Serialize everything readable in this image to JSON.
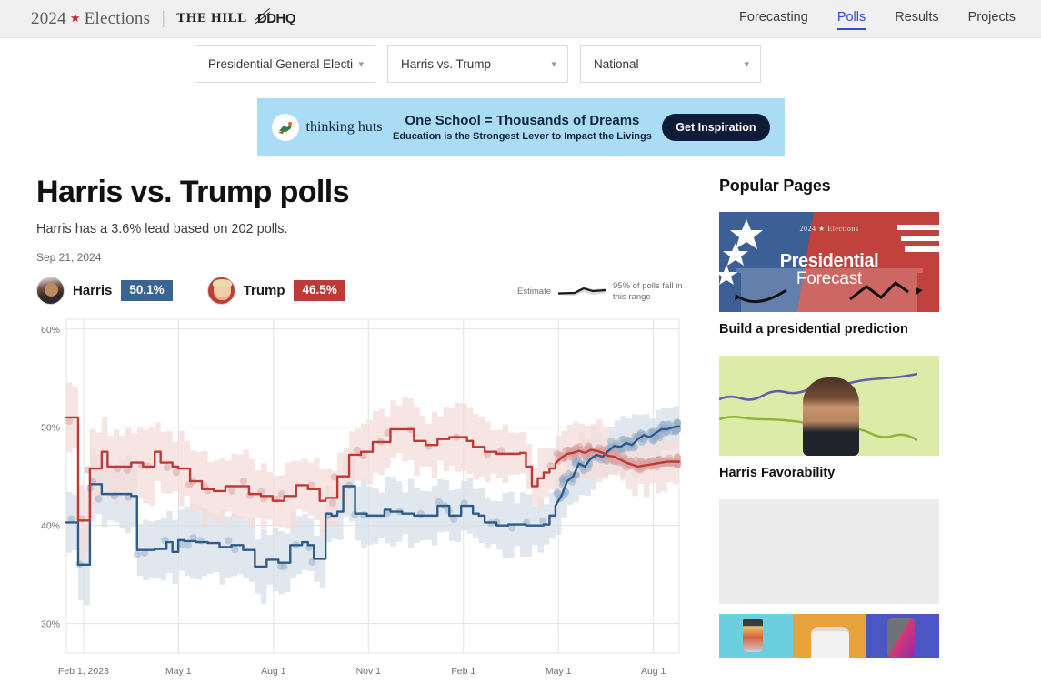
{
  "header": {
    "brand_year": "2024",
    "brand_star": "★",
    "brand_elections": "Elections",
    "brand_divider": "|",
    "brand_hill": "THE HILL",
    "brand_ddhq": "DDHQ",
    "nav": [
      {
        "label": "Forecasting",
        "active": false
      },
      {
        "label": "Polls",
        "active": true
      },
      {
        "label": "Results",
        "active": false
      },
      {
        "label": "Projects",
        "active": false
      }
    ],
    "accent_color": "#2f4ed8"
  },
  "filters": [
    {
      "name": "race-type",
      "value": "Presidential General Electi",
      "chevron": "chevron-down-icon"
    },
    {
      "name": "matchup",
      "value": "Harris vs. Trump",
      "chevron": "chevron-down-icon"
    },
    {
      "name": "geography",
      "value": "National",
      "chevron": "chevron-down-icon"
    }
  ],
  "ad": {
    "brand": "thinking huts",
    "logo_icon": "bird-icon",
    "logo_glyph": "🐦",
    "headline": "One School = Thousands of Dreams",
    "subline": "Education is the Strongest Lever to Impact the Livings",
    "cta": "Get Inspiration",
    "bg_color": "#abdcf5",
    "cta_color": "#101b39"
  },
  "main": {
    "title": "Harris vs. Trump polls",
    "subtitle": "Harris has a 3.6% lead based on 202 polls.",
    "date": "Sep 21, 2024",
    "candidates": [
      {
        "name": "Harris",
        "value": "50.1%",
        "color": "#3a6494",
        "avatar": "harris-avatar"
      },
      {
        "name": "Trump",
        "value": "46.5%",
        "color": "#bc3b36",
        "avatar": "trump-avatar"
      }
    ],
    "chart_legend": {
      "estimate_label": "Estimate",
      "range_label_line1": "95% of polls fall",
      "range_label_line2": "in this range"
    }
  },
  "chart_data": {
    "type": "line",
    "title": "Harris vs. Trump polls",
    "xlabel": "",
    "ylabel": "",
    "ylim": [
      27,
      61
    ],
    "yticks": [
      30,
      40,
      50,
      60
    ],
    "ytick_labels": [
      "30%",
      "40%",
      "50%",
      "60%"
    ],
    "xticks": [
      "Feb 1, 2023",
      "May 1",
      "Aug 1",
      "Nov 1",
      "Feb 1",
      "May 1",
      "Aug 1"
    ],
    "xtick_positions": [
      0.028,
      0.183,
      0.338,
      0.493,
      0.648,
      0.803,
      0.958
    ],
    "grid": true,
    "legend_position": "top-right",
    "band_label": "95% of polls fall in this range",
    "series": [
      {
        "name": "Harris",
        "color": "#2e5c8a",
        "band_color": "#d7dfe9",
        "dot_color": "#93aec8",
        "final_value": 50.1,
        "values": [
          40.3,
          40.3,
          36.0,
          36.0,
          44.2,
          44.2,
          43.2,
          43.2,
          43.2,
          43.2,
          43.2,
          43.0,
          37.5,
          37.5,
          37.5,
          37.6,
          37.6,
          38.3,
          37.3,
          38.5,
          38.4,
          38.4,
          38.3,
          38.3,
          38.2,
          38.2,
          37.8,
          37.8,
          38.0,
          38.0,
          37.5,
          37.5,
          35.8,
          35.8,
          36.5,
          36.5,
          36.2,
          36.2,
          38.0,
          38.0,
          38.3,
          38.0,
          36.6,
          36.6,
          41.2,
          41.0,
          41.4,
          44.0,
          44.0,
          41.2,
          41.2,
          41.0,
          41.0,
          41.0,
          41.6,
          41.4,
          41.4,
          41.2,
          41.2,
          41.0,
          41.0,
          41.0,
          41.0,
          42.0,
          42.0,
          41.0,
          41.0,
          42.0,
          42.0,
          41.2,
          41.0,
          40.3,
          40.3,
          40.0,
          40.0,
          40.1,
          40.1,
          40.1,
          40.0,
          40.0,
          40.0,
          40.1,
          41.0,
          42.0,
          43.0,
          44.5,
          45.0,
          46.3,
          46.0,
          46.8,
          47.2,
          47.0,
          47.6,
          48.1,
          48.0,
          48.4,
          48.2,
          48.8,
          49.2,
          49.0,
          49.4,
          49.8,
          49.8,
          50.0,
          50.1
        ]
      },
      {
        "name": "Trump",
        "color": "#bc3b36",
        "band_color": "#f3dcda",
        "dot_color": "#d9a0a0",
        "final_value": 46.5,
        "values": [
          51.0,
          51.0,
          40.5,
          40.5,
          45.8,
          45.8,
          47.5,
          46.0,
          46.0,
          46.0,
          46.0,
          46.4,
          46.4,
          46.0,
          46.0,
          47.5,
          46.4,
          46.4,
          46.0,
          45.8,
          45.8,
          44.5,
          44.5,
          43.7,
          43.7,
          43.5,
          43.5,
          44.0,
          44.0,
          44.0,
          44.0,
          43.2,
          43.2,
          43.0,
          43.0,
          42.5,
          42.5,
          43.0,
          43.0,
          44.1,
          44.1,
          43.7,
          43.7,
          42.5,
          42.8,
          42.8,
          45.0,
          45.0,
          47.2,
          47.2,
          47.5,
          47.5,
          48.5,
          48.5,
          48.5,
          49.8,
          49.8,
          49.8,
          49.8,
          48.6,
          48.6,
          48.2,
          48.2,
          48.8,
          48.8,
          49.0,
          49.0,
          49.0,
          48.6,
          48.0,
          48.0,
          47.5,
          47.5,
          47.3,
          47.3,
          47.3,
          47.3,
          47.4,
          46.0,
          44.0,
          44.8,
          45.4,
          45.8,
          46.3,
          46.9,
          47.3,
          47.4,
          47.6,
          47.4,
          47.7,
          47.6,
          47.4,
          47.1,
          47.0,
          46.7,
          46.4,
          46.2,
          46.0,
          46.1,
          46.2,
          46.3,
          46.4,
          46.5,
          46.5,
          46.5
        ]
      }
    ]
  },
  "sidebar": {
    "heading": "Popular Pages",
    "cards": [
      {
        "thumb_kind": "presidential-forecast",
        "thumb_top_text": "2024 ★ Elections",
        "thumb_title_1": "Presidential",
        "thumb_title_2": "Forecast",
        "caption": "Build a presidential prediction"
      },
      {
        "thumb_kind": "harris-favorability",
        "caption": "Harris Favorability"
      }
    ],
    "product_ads": [
      {
        "name": "blender-ad"
      },
      {
        "name": "bag-ad"
      },
      {
        "name": "phone-ad"
      }
    ]
  }
}
